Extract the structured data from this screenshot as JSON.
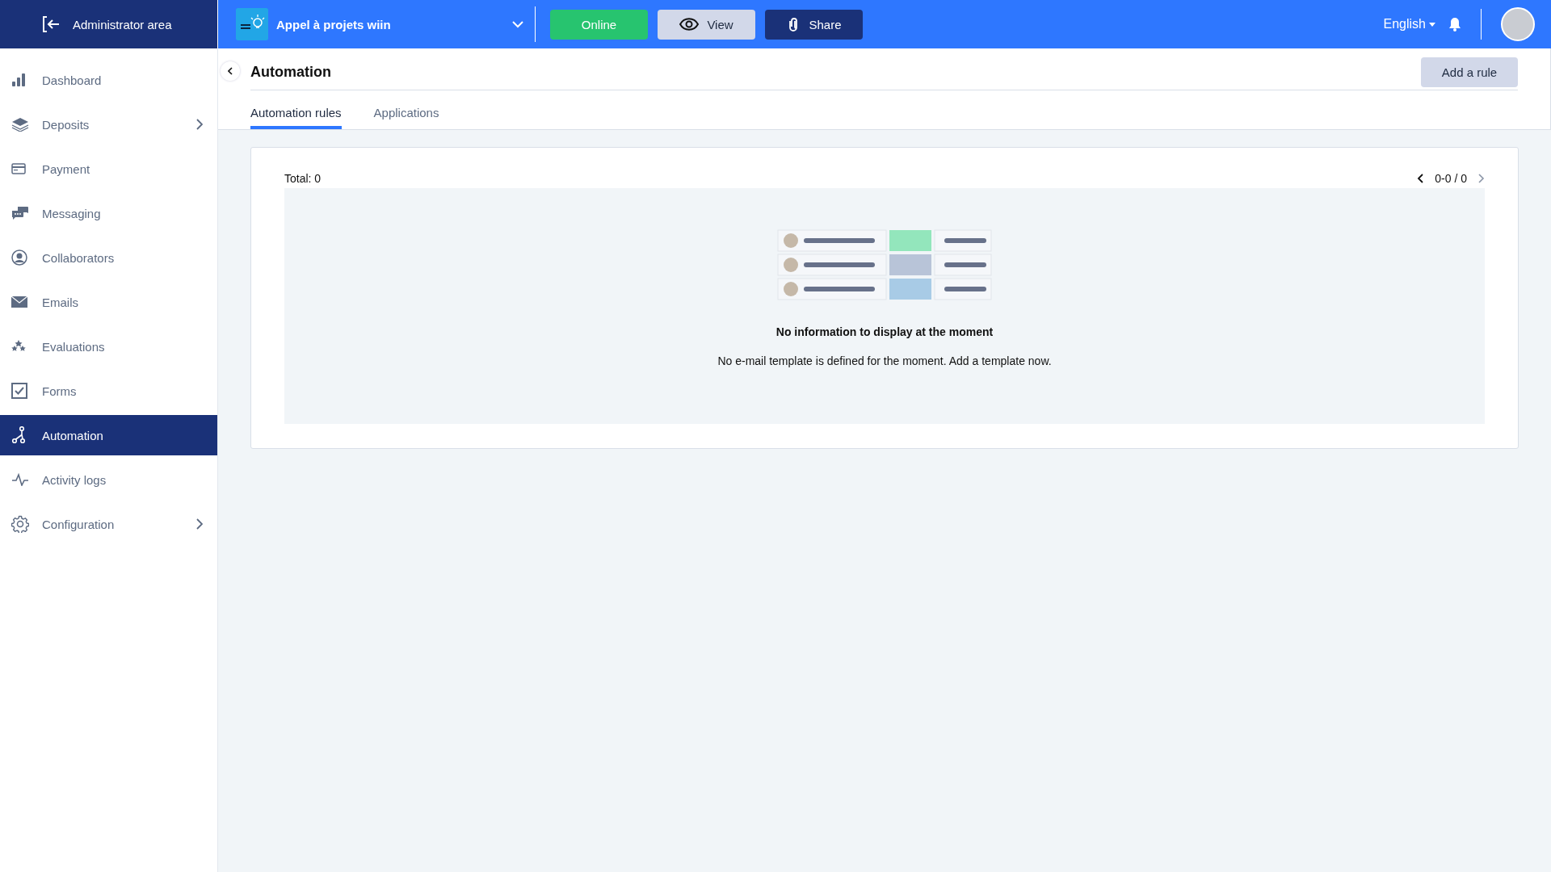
{
  "topbar": {
    "admin_link": "Administrator area",
    "project_name": "Appel à projets wiin",
    "status_button": "Online",
    "view_button": "View",
    "share_button": "Share",
    "language": "English"
  },
  "sidebar": {
    "items": [
      {
        "label": "Dashboard",
        "kind": "bars",
        "selected": false,
        "expandable": false
      },
      {
        "label": "Deposits",
        "kind": "layers",
        "selected": false,
        "expandable": true
      },
      {
        "label": "Payment",
        "kind": "card",
        "selected": false,
        "expandable": false
      },
      {
        "label": "Messaging",
        "kind": "chat",
        "selected": false,
        "expandable": false
      },
      {
        "label": "Collaborators",
        "kind": "user",
        "selected": false,
        "expandable": false
      },
      {
        "label": "Emails",
        "kind": "mail",
        "selected": false,
        "expandable": false
      },
      {
        "label": "Evaluations",
        "kind": "stars",
        "selected": false,
        "expandable": false
      },
      {
        "label": "Forms",
        "kind": "check",
        "selected": false,
        "expandable": false
      },
      {
        "label": "Automation",
        "kind": "flow",
        "selected": true,
        "expandable": false
      },
      {
        "label": "Activity logs",
        "kind": "pulse",
        "selected": false,
        "expandable": false
      },
      {
        "label": "Configuration",
        "kind": "gear",
        "selected": false,
        "expandable": true
      }
    ]
  },
  "page": {
    "title": "Automation",
    "add_button": "Add a rule",
    "tabs": [
      {
        "label": "Automation rules",
        "selected": true
      },
      {
        "label": "Applications",
        "selected": false
      }
    ],
    "total": "Total: 0",
    "pagination": "0-0 / 0",
    "empty_state": {
      "title": "No information to display at the moment",
      "message": "No e-mail template is defined for the moment. Add a template now."
    }
  }
}
